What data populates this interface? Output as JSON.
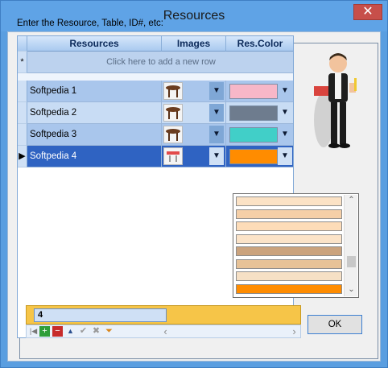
{
  "window": {
    "title": "Resources",
    "close_glyph": "✕"
  },
  "prompt": "Enter the Resource, Table, ID#, etc:",
  "columns": [
    "Resources",
    "Images",
    "Res.Color"
  ],
  "new_row_text": "Click here to add a new row",
  "new_row_indicator": "*",
  "rows": [
    {
      "resource": "Softpedia 1",
      "color": "#f7b7c8",
      "image": "table-icon",
      "selected": false
    },
    {
      "resource": "Softpedia 2",
      "color": "#6e7c8e",
      "image": "table-icon",
      "selected": false
    },
    {
      "resource": "Softpedia 3",
      "color": "#41cfc8",
      "image": "table-icon",
      "selected": false
    },
    {
      "resource": "Softpedia 4",
      "color": "#ff8c00",
      "image": "red-table-icon",
      "selected": true
    }
  ],
  "dropdown_colors": [
    "#fbe2c5",
    "#f5cfa7",
    "#fddcb8",
    "#fbe3c8",
    "#cba37d",
    "#e7c297",
    "#f6e0c5",
    "#ff8c00"
  ],
  "filter_value": "4",
  "selected_indicator": "▶",
  "dropdown_glyph": "▼",
  "scroll_up": "⌃",
  "scroll_down": "⌄",
  "ok_label": "OK",
  "nav": {
    "first": "|◀",
    "add": "+",
    "remove": "−",
    "up": "▲",
    "check": "✔",
    "cancel": "✖",
    "filter": "⏷",
    "left": "‹",
    "right": "›"
  }
}
